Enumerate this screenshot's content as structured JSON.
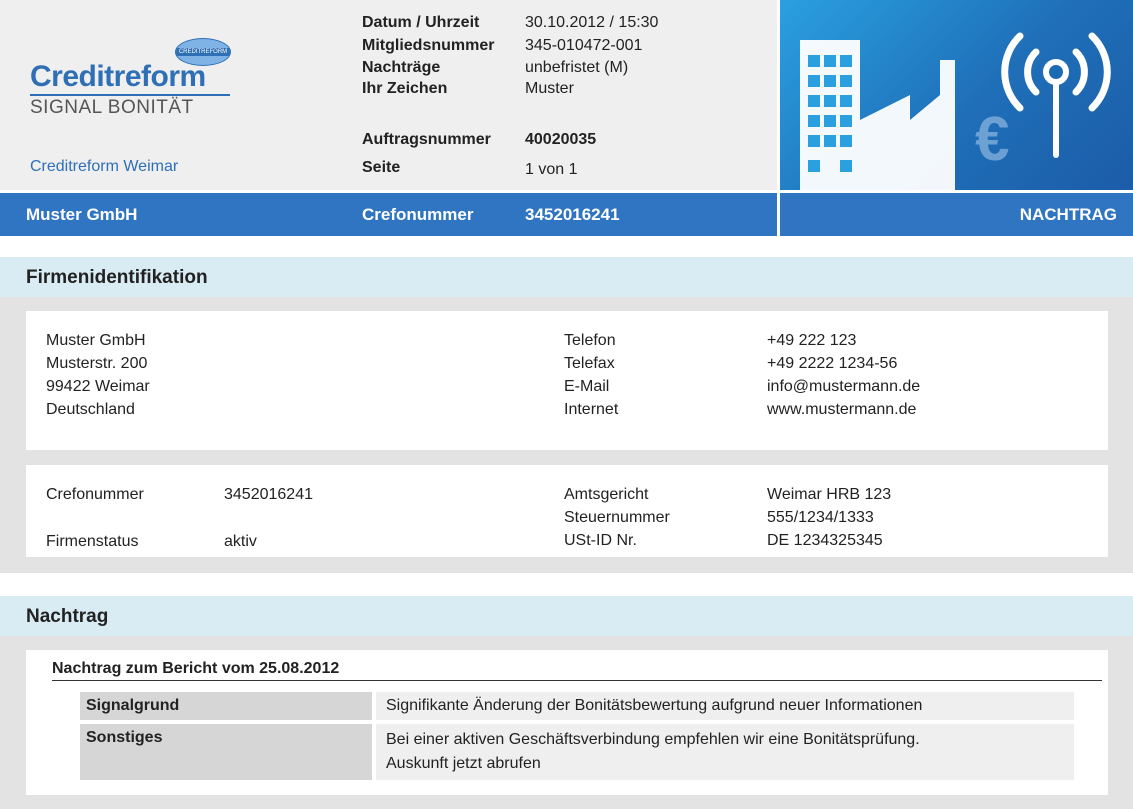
{
  "header": {
    "logo_text": "Creditreform",
    "logo_globe_text": "CREDITREFORM",
    "logo_subtitle": "SIGNAL BONITÄT",
    "branch": "Creditreform Weimar",
    "meta": [
      {
        "label": "Datum / Uhrzeit",
        "value": "30.10.2012 / 15:30"
      },
      {
        "label": "Mitgliedsnummer",
        "value": "345-010472-001"
      },
      {
        "label": "Nachträge",
        "value": "unbefristet (M)"
      },
      {
        "label": "Ihr Zeichen",
        "value": "Muster"
      },
      {
        "label": "Auftragsnummer",
        "value": "40020035"
      },
      {
        "label": "Seite",
        "value": "1 von 1"
      }
    ]
  },
  "bar": {
    "company": "Muster GmbH",
    "crefo_label": "Crefonummer",
    "crefo_value": "3452016241",
    "type": "NACHTRAG"
  },
  "firmenidentifikation": {
    "title": "Firmenidentifikation",
    "address": [
      "Muster GmbH",
      "Musterstr. 200",
      "99422 Weimar",
      "Deutschland"
    ],
    "contact_labels": [
      "Telefon",
      "Telefax",
      "E-Mail",
      "Internet"
    ],
    "contact_values": [
      "+49 222 123",
      "+49 2222 1234-56",
      "info@mustermann.de",
      "www.mustermann.de"
    ],
    "crefo_label": "Crefonummer",
    "crefo_value": "3452016241",
    "status_label": "Firmenstatus",
    "status_value": "aktiv",
    "reg_labels": [
      "Amtsgericht",
      "Steuernummer",
      "USt-ID Nr."
    ],
    "reg_values": [
      "Weimar HRB 123",
      "555/1234/1333",
      "DE 1234325345"
    ]
  },
  "nachtrag": {
    "title": "Nachtrag",
    "subtitle": "Nachtrag zum Bericht vom 25.08.2012",
    "rows": [
      {
        "label": "Signalgrund",
        "value": "Signifikante Änderung der Bonitätsbewertung aufgrund neuer Informationen"
      },
      {
        "label": "Sonstiges",
        "value": "Bei einer aktiven Geschäftsverbindung empfehlen wir eine Bonitätsprüfung.",
        "value2": "Auskunft jetzt abrufen"
      }
    ]
  },
  "colors": {
    "brand_blue": "#2f75c2",
    "section_bg": "#d9ecf4"
  }
}
